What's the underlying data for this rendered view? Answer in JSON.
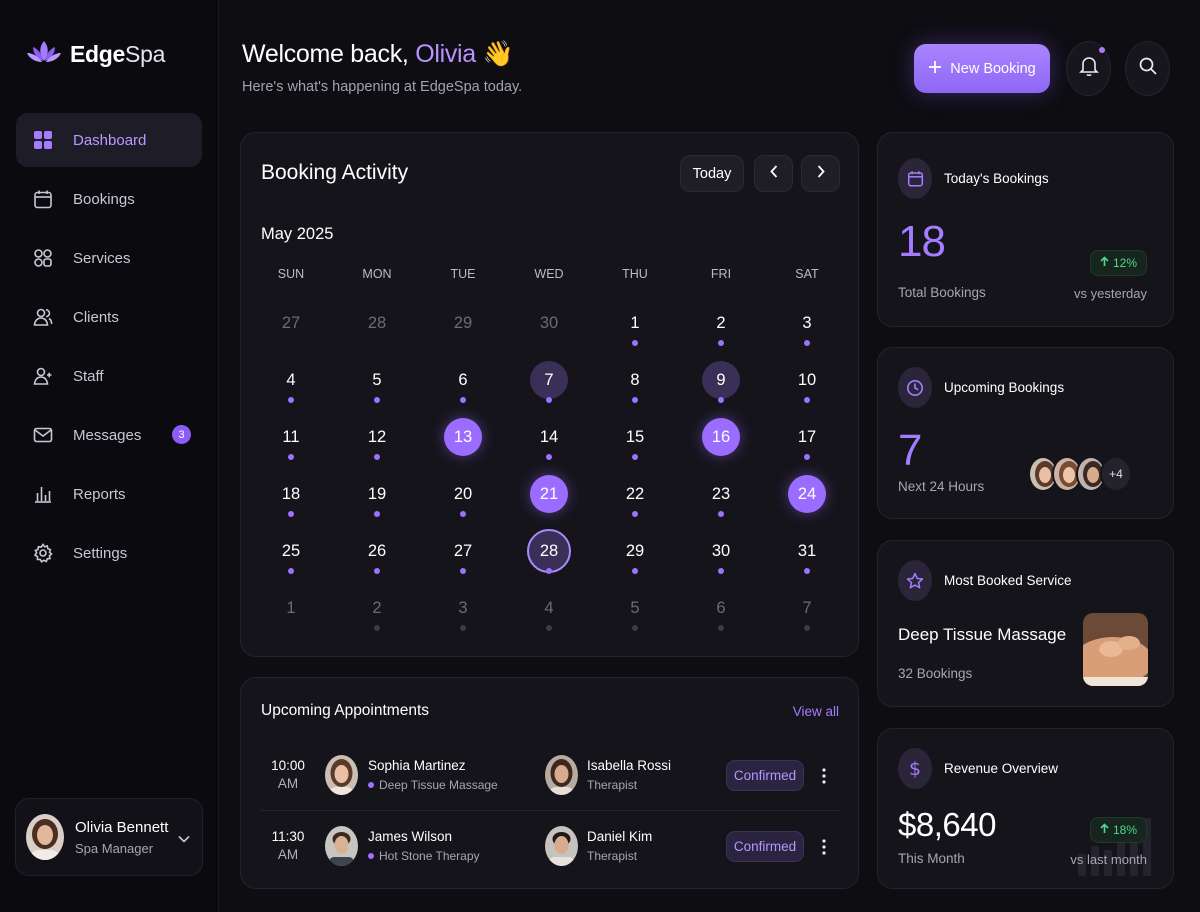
{
  "app": {
    "name_bold": "Edge",
    "name_light": "Spa"
  },
  "sidebar": {
    "items": [
      {
        "label": "Dashboard",
        "icon": "dashboard-grid-icon",
        "active": true
      },
      {
        "label": "Bookings",
        "icon": "calendar-icon"
      },
      {
        "label": "Services",
        "icon": "services-grid-icon"
      },
      {
        "label": "Clients",
        "icon": "clients-icon"
      },
      {
        "label": "Staff",
        "icon": "staff-icon"
      },
      {
        "label": "Messages",
        "icon": "mail-icon",
        "badge": "3"
      },
      {
        "label": "Reports",
        "icon": "bar-chart-icon"
      },
      {
        "label": "Settings",
        "icon": "gear-icon"
      }
    ],
    "profile": {
      "name": "Olivia Bennett",
      "role": "Spa Manager"
    }
  },
  "header": {
    "greeting": "Welcome back,",
    "name": "Olivia",
    "emoji": "👋",
    "subtitle": "Here's what's happening at EdgeSpa today.",
    "new_booking": "New Booking"
  },
  "calendar": {
    "title": "Booking Activity",
    "today_label": "Today",
    "month": "May 2025",
    "weekdays": [
      "SUN",
      "MON",
      "TUE",
      "WED",
      "THU",
      "FRI",
      "SAT"
    ],
    "weeks": [
      [
        {
          "d": "27",
          "faded": true
        },
        {
          "d": "28",
          "faded": true
        },
        {
          "d": "29",
          "faded": true
        },
        {
          "d": "30",
          "faded": true
        },
        {
          "d": "1",
          "dot": true
        },
        {
          "d": "2",
          "dot": true
        },
        {
          "d": "3",
          "dot": true
        }
      ],
      [
        {
          "d": "4",
          "dot": true
        },
        {
          "d": "5",
          "dot": true
        },
        {
          "d": "6",
          "dot": true
        },
        {
          "d": "7",
          "dot": true,
          "state": "soft"
        },
        {
          "d": "8",
          "dot": true
        },
        {
          "d": "9",
          "dot": true,
          "state": "soft"
        },
        {
          "d": "10",
          "dot": true
        }
      ],
      [
        {
          "d": "11",
          "dot": true
        },
        {
          "d": "12",
          "dot": true
        },
        {
          "d": "13",
          "state": "hl"
        },
        {
          "d": "14",
          "dot": true
        },
        {
          "d": "15",
          "dot": true
        },
        {
          "d": "16",
          "state": "hl"
        },
        {
          "d": "17",
          "dot": true
        }
      ],
      [
        {
          "d": "18",
          "dot": true
        },
        {
          "d": "19",
          "dot": true
        },
        {
          "d": "20",
          "dot": true
        },
        {
          "d": "21",
          "state": "hl"
        },
        {
          "d": "22",
          "dot": true
        },
        {
          "d": "23",
          "dot": true
        },
        {
          "d": "24",
          "state": "hl"
        }
      ],
      [
        {
          "d": "25",
          "dot": true
        },
        {
          "d": "26",
          "dot": true
        },
        {
          "d": "27",
          "dot": true
        },
        {
          "d": "28",
          "dot": true,
          "state": "today"
        },
        {
          "d": "29",
          "dot": true
        },
        {
          "d": "30",
          "dot": true
        },
        {
          "d": "31",
          "dot": true
        }
      ],
      [
        {
          "d": "1",
          "faded": true
        },
        {
          "d": "2",
          "faded": true,
          "dim": true
        },
        {
          "d": "3",
          "faded": true,
          "dim": true
        },
        {
          "d": "4",
          "faded": true,
          "dim": true
        },
        {
          "d": "5",
          "faded": true,
          "dim": true
        },
        {
          "d": "6",
          "faded": true,
          "dim": true
        },
        {
          "d": "7",
          "faded": true,
          "dim": true
        }
      ]
    ]
  },
  "appointments": {
    "title": "Upcoming Appointments",
    "view_all": "View all",
    "rows": [
      {
        "time": "10:00",
        "ampm": "AM",
        "client": "Sophia Martinez",
        "service": "Deep Tissue Massage",
        "staff": "Isabella Rossi",
        "staff_role": "Therapist",
        "status": "Confirmed"
      },
      {
        "time": "11:30",
        "ampm": "AM",
        "client": "James Wilson",
        "service": "Hot Stone Therapy",
        "staff": "Daniel Kim",
        "staff_role": "Therapist",
        "status": "Confirmed"
      }
    ]
  },
  "stats": {
    "today": {
      "label": "Today's Bookings",
      "value": "18",
      "sub": "Total Bookings",
      "trend": "12%",
      "trend_sub": "vs yesterday"
    },
    "upcoming": {
      "label": "Upcoming Bookings",
      "value": "7",
      "sub": "Next 24 Hours",
      "more": "+4"
    },
    "service": {
      "label": "Most Booked Service",
      "name": "Deep Tissue Massage",
      "count": "32 Bookings"
    },
    "revenue": {
      "label": "Revenue Overview",
      "value": "$8,640",
      "sub": "This Month",
      "trend": "18%",
      "trend_sub": "vs last month"
    }
  },
  "colors": {
    "accent": "#9a6cff",
    "background": "#0e0d12",
    "card": "#15141b",
    "positive": "#4fd88e"
  }
}
